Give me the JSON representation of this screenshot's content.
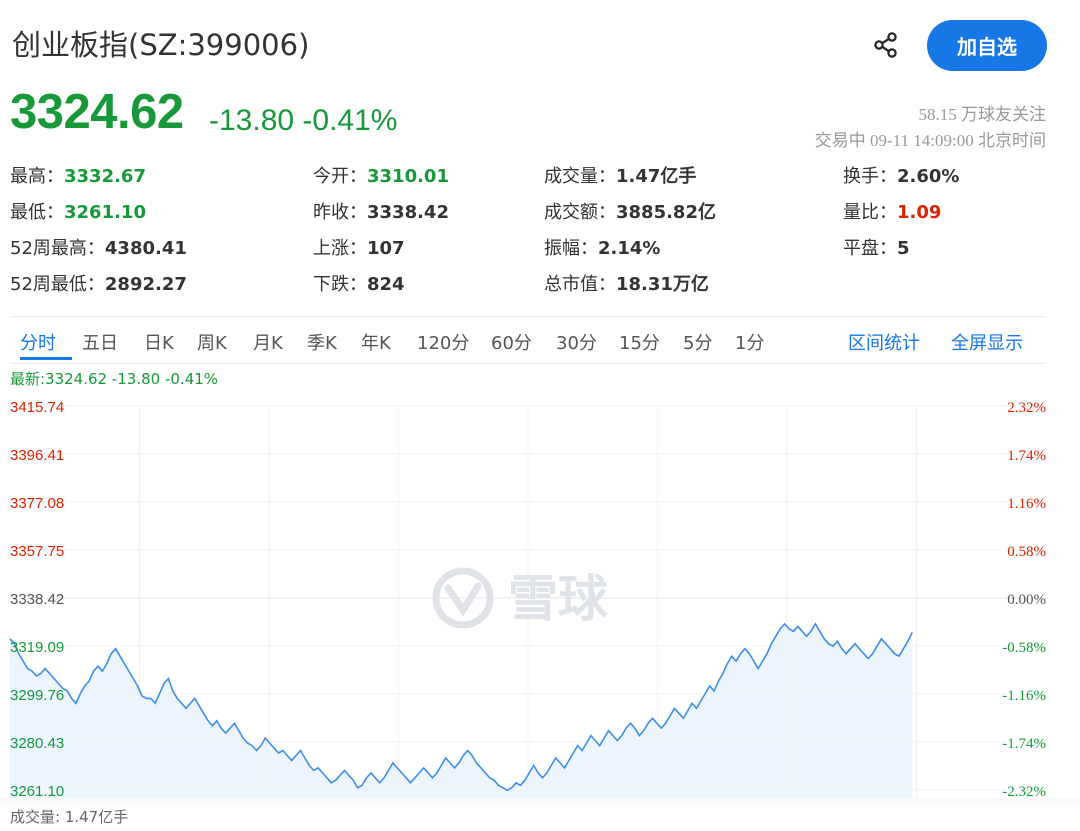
{
  "stock": {
    "name": "创业板指(SZ:399006)",
    "price": "3324.62",
    "change": "-13.80",
    "change_pct": "-0.41%",
    "followers": "58.15 万球友关注",
    "status": "交易中 09-11 14:09:00 北京时间"
  },
  "actions": {
    "follow_label": "加自选",
    "share_icon": "share-icon"
  },
  "quote": [
    {
      "label": "最高：",
      "value": "3332.67",
      "color": "green"
    },
    {
      "label": "今开：",
      "value": "3310.01",
      "color": "green"
    },
    {
      "label": "成交量：",
      "value": "1.47亿手",
      "color": "normal"
    },
    {
      "label": "换手：",
      "value": "2.60%",
      "color": "normal"
    },
    {
      "label": "最低：",
      "value": "3261.10",
      "color": "green"
    },
    {
      "label": "昨收：",
      "value": "3338.42",
      "color": "normal"
    },
    {
      "label": "成交额：",
      "value": "3885.82亿",
      "color": "normal"
    },
    {
      "label": "量比：",
      "value": "1.09",
      "color": "red"
    },
    {
      "label": "52周最高：",
      "value": "4380.41",
      "color": "normal"
    },
    {
      "label": "上涨：",
      "value": "107",
      "color": "normal"
    },
    {
      "label": "振幅：",
      "value": "2.14%",
      "color": "normal"
    },
    {
      "label": "平盘：",
      "value": "5",
      "color": "normal"
    },
    {
      "label": "52周最低：",
      "value": "2892.27",
      "color": "normal"
    },
    {
      "label": "下跌：",
      "value": "824",
      "color": "normal"
    },
    {
      "label": "总市值：",
      "value": "18.31万亿",
      "color": "normal"
    }
  ],
  "tabs": [
    "分时",
    "五日",
    "日K",
    "周K",
    "月K",
    "季K",
    "年K",
    "120分",
    "60分",
    "30分",
    "15分",
    "5分",
    "1分"
  ],
  "active_tab": "分时",
  "tab_links": [
    "区间统计",
    "全屏显示"
  ],
  "latest_line": "最新:3324.62 -13.80 -0.41%",
  "watermark": "雪球",
  "volume_label": "成交量: 1.47亿手",
  "colors": {
    "up": "#dd2200",
    "down": "#17993a",
    "accent": "#1677e6",
    "line": "#3d8fe6",
    "fill": "#eaf3fd"
  },
  "chart_data": {
    "type": "area",
    "ylim": [
      3261.1,
      3415.74
    ],
    "y_ticks_left": [
      "3415.74",
      "3396.41",
      "3377.08",
      "3357.75",
      "3338.42",
      "3319.09",
      "3299.76",
      "3280.43",
      "3261.10"
    ],
    "y_ticks_right": [
      "2.32%",
      "1.74%",
      "1.16%",
      "0.58%",
      "0.00%",
      "-0.58%",
      "-1.16%",
      "-1.74%",
      "-2.32%"
    ],
    "tick_values": [
      3415.74,
      3396.41,
      3377.08,
      3357.75,
      3338.42,
      3319.09,
      3299.76,
      3280.43,
      3261.1
    ],
    "prev_close": 3338.42,
    "total_minutes": 240,
    "elapsed_minutes": 209,
    "series": [
      {
        "values": [
          3322,
          3320,
          3316,
          3313,
          3310,
          3309,
          3307,
          3308,
          3310,
          3308,
          3306,
          3304,
          3302,
          3301,
          3298,
          3296,
          3300,
          3303,
          3305,
          3309,
          3311,
          3309,
          3312,
          3316,
          3318,
          3315,
          3312,
          3309,
          3306,
          3303,
          3299,
          3298,
          3298,
          3296,
          3300,
          3304,
          3306,
          3301,
          3298,
          3296,
          3294,
          3296,
          3298,
          3295,
          3292,
          3289,
          3287,
          3289,
          3286,
          3284,
          3286,
          3288,
          3285,
          3282,
          3280,
          3279,
          3277,
          3279,
          3282,
          3280,
          3278,
          3276,
          3277,
          3275,
          3273,
          3275,
          3277,
          3274,
          3271,
          3269,
          3270,
          3268,
          3266,
          3264,
          3265,
          3267,
          3269,
          3267,
          3265,
          3262,
          3263,
          3266,
          3268,
          3266,
          3264,
          3266,
          3269,
          3272,
          3270,
          3268,
          3266,
          3264,
          3266,
          3268,
          3270,
          3268,
          3266,
          3268,
          3271,
          3274,
          3272,
          3270,
          3272,
          3275,
          3277,
          3275,
          3272,
          3270,
          3268,
          3266,
          3265,
          3263,
          3262,
          3261,
          3262,
          3264,
          3263,
          3265,
          3268,
          3271,
          3268,
          3266,
          3268,
          3271,
          3274,
          3272,
          3270,
          3273,
          3276,
          3279,
          3277,
          3280,
          3283,
          3281,
          3279,
          3282,
          3285,
          3283,
          3281,
          3283,
          3286,
          3288,
          3286,
          3283,
          3285,
          3288,
          3290,
          3288,
          3286,
          3288,
          3291,
          3294,
          3292,
          3290,
          3293,
          3296,
          3294,
          3297,
          3300,
          3303,
          3301,
          3305,
          3308,
          3312,
          3315,
          3313,
          3316,
          3318,
          3316,
          3313,
          3310,
          3313,
          3316,
          3320,
          3323,
          3326,
          3328,
          3326,
          3325,
          3327,
          3325,
          3323,
          3325,
          3328,
          3325,
          3322,
          3320,
          3319,
          3321,
          3318,
          3316,
          3318,
          3320,
          3318,
          3316,
          3314,
          3316,
          3319,
          3322,
          3320,
          3318,
          3316,
          3315,
          3318,
          3321,
          3324.62
        ]
      }
    ]
  }
}
